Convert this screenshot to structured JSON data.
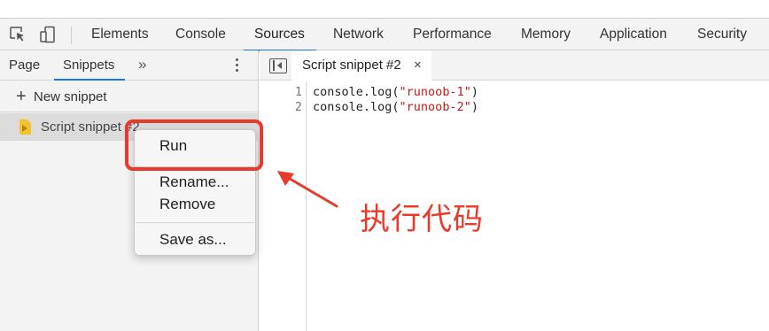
{
  "tabs": [
    {
      "label": "Elements"
    },
    {
      "label": "Console"
    },
    {
      "label": "Sources"
    },
    {
      "label": "Network"
    },
    {
      "label": "Performance"
    },
    {
      "label": "Memory"
    },
    {
      "label": "Application"
    },
    {
      "label": "Security"
    }
  ],
  "active_tab": "Sources",
  "left_panel": {
    "tabs": [
      "Page",
      "Snippets"
    ],
    "more": "»",
    "new_snippet": "New snippet",
    "snippet_item": "Script snippet #2"
  },
  "editor": {
    "tab_label": "Script snippet #2",
    "close": "×",
    "lines": [
      {
        "num": "1",
        "prefix": "console.log(",
        "string": "\"runoob-1\"",
        "suffix": ")"
      },
      {
        "num": "2",
        "prefix": "console.log(",
        "string": "\"runoob-2\"",
        "suffix": ")"
      }
    ]
  },
  "context_menu": {
    "items": [
      "Run",
      "Rename...",
      "Remove",
      "Save as..."
    ]
  },
  "annotation": "执行代码",
  "colors": {
    "accent": "#1a73e8",
    "highlight": "#e8392b",
    "string": "#c41a16",
    "snippet_icon": "#f2c230"
  }
}
